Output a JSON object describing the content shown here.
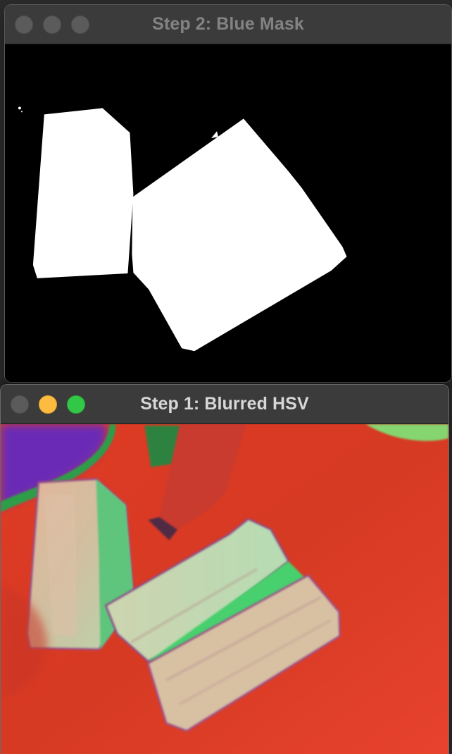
{
  "windows": {
    "mask": {
      "title": "Step 2: Blue Mask",
      "active": false
    },
    "hsv": {
      "title": "Step 1: Blurred HSV",
      "active": true
    }
  },
  "icons": {
    "close": "close-icon",
    "minimize": "minimize-icon",
    "zoom": "zoom-icon"
  },
  "colors": {
    "titlebar": "#3b3b3b",
    "mask_background": "#000000",
    "mask_foreground": "#ffffff",
    "hsv_background": "#e23c24",
    "traffic_red": "#ff5f57",
    "traffic_yellow": "#fdbc40",
    "traffic_green": "#33c748",
    "traffic_inactive": "#5b5b5b"
  }
}
